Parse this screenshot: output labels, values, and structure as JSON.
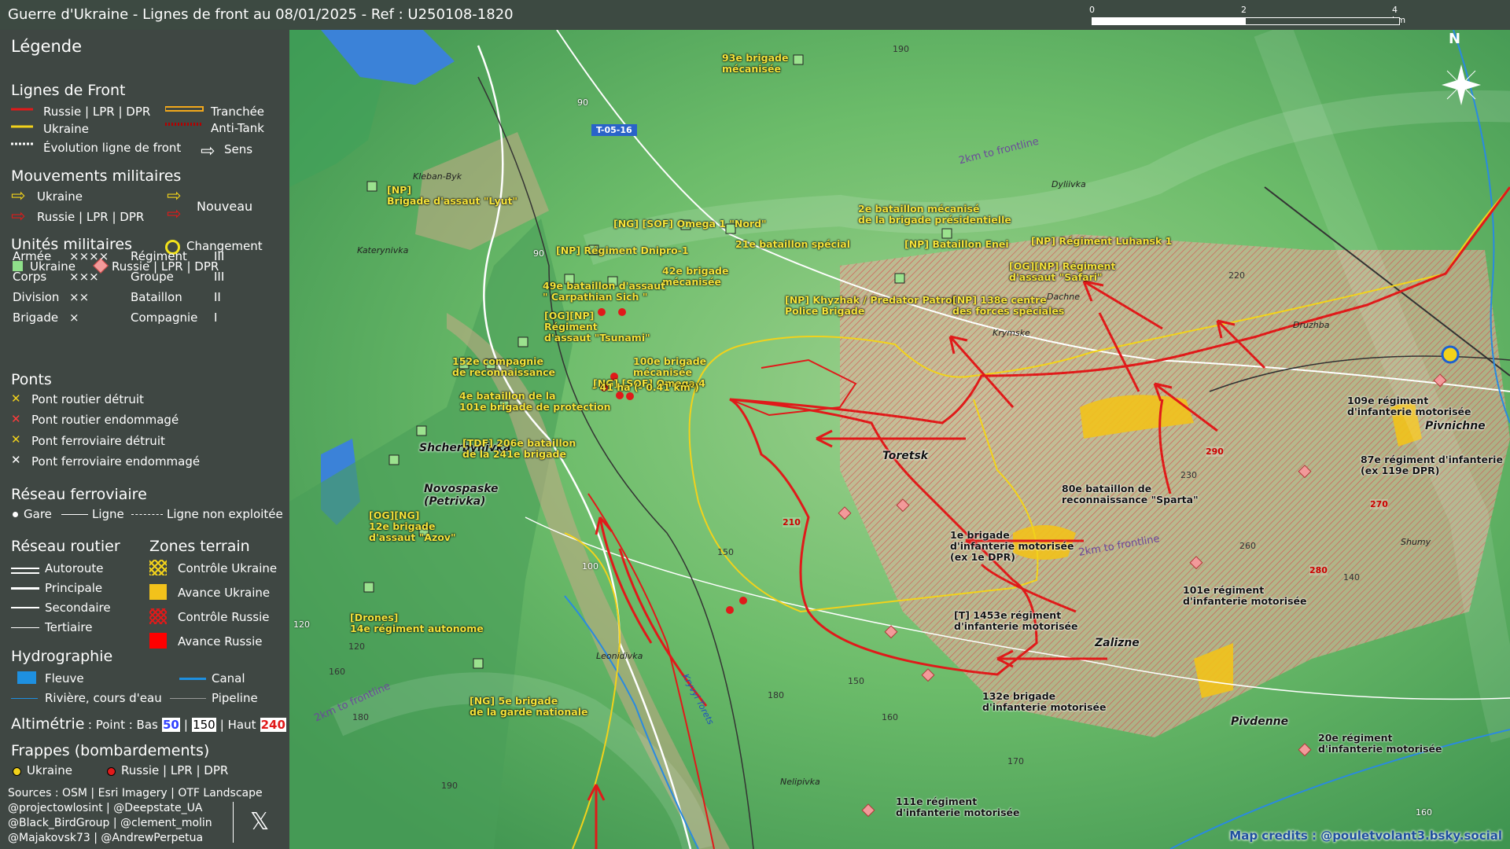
{
  "title": "Guerre d'Ukraine - Lignes de front au 08/01/2025 - Ref : U250108-1820",
  "scale": {
    "l0": "0",
    "l1": "2",
    "l2": "4 km"
  },
  "north": "N",
  "colors": {
    "russia": "#e01a1a",
    "ukraine": "#f2d21b",
    "legend_bg": "#3f4743"
  },
  "legend": {
    "title": "Légende",
    "front": {
      "title": "Lignes de Front",
      "russia": "Russie | LPR | DPR",
      "ukraine": "Ukraine",
      "tranchee": "Tranchée",
      "antitank": "Anti-Tank",
      "evolution": "Évolution ligne de front",
      "sens": "Sens"
    },
    "moves": {
      "title": "Mouvements militaires",
      "ukraine": "Ukraine",
      "russia": "Russie | LPR | DPR",
      "nouveau": "Nouveau"
    },
    "units": {
      "title": "Unités militaires",
      "changement": "Changement",
      "ukraine": "Ukraine",
      "russia": "Russie | LPR | DPR",
      "rows": [
        {
          "a": "Armée",
          "as": "××××",
          "b": "Régiment",
          "bs": "III"
        },
        {
          "a": "Corps",
          "as": "×××",
          "b": "Groupe",
          "bs": "III"
        },
        {
          "a": "Division",
          "as": "××",
          "b": "Bataillon",
          "bs": "II"
        },
        {
          "a": "Brigade",
          "as": "×",
          "b": "Compagnie",
          "bs": "I"
        }
      ]
    },
    "bridges": {
      "title": "Ponts",
      "b1": "Pont routier détruit",
      "b2": "Pont routier endommagé",
      "b3": "Pont ferroviaire détruit",
      "b4": "Pont ferroviaire endommagé"
    },
    "rail": {
      "title": "Réseau ferroviaire",
      "gare": "Gare",
      "ligne": "Ligne",
      "non": "Ligne non exploitée"
    },
    "road": {
      "title": "Réseau routier",
      "r1": "Autoroute",
      "r2": "Principale",
      "r3": "Secondaire",
      "r4": "Tertiaire"
    },
    "zones": {
      "title": "Zones terrain",
      "z1": "Contrôle Ukraine",
      "z2": "Avance Ukraine",
      "z3": "Contrôle Russie",
      "z4": "Avance Russie"
    },
    "hydro": {
      "title": "Hydrographie",
      "h1": "Fleuve",
      "h2": "Canal",
      "h3": "Rivière, cours d'eau",
      "h4": "Pipeline"
    },
    "alti": {
      "title": "Altimétrie",
      "point": ": Point : Bas",
      "low": "50",
      "mid": "150",
      "haut": "| Haut",
      "high": "240",
      "sep": "|"
    },
    "strikes": {
      "title": "Frappes (bombardements)",
      "ukraine": "Ukraine",
      "russia": "Russie | LPR | DPR"
    },
    "sources": [
      "Sources : OSM | Esri Imagery | OTF Landscape",
      "@projectowlosint | @Deepstate_UA",
      "@Black_BirdGroup | @clement_molin",
      "@Majakovsk73 | @AndrewPerpetua"
    ]
  },
  "map": {
    "places": [
      {
        "t": "Toretsk"
      },
      {
        "t": "Pivnichne"
      },
      {
        "t": "Zalizne"
      },
      {
        "t": "Pivdenne"
      },
      {
        "t": "Shcherbynivka"
      },
      {
        "t": "Novospaske\n(Petrivka)"
      }
    ],
    "small_places": [
      {
        "t": "Kleban-Byk"
      },
      {
        "t": "Katerynivka"
      },
      {
        "t": "Dyliivka"
      },
      {
        "t": "Dachne"
      },
      {
        "t": "Krymske"
      },
      {
        "t": "Druzhba"
      },
      {
        "t": "Shumy"
      },
      {
        "t": "Leonidivka"
      },
      {
        "t": "Nelipivka"
      }
    ],
    "ua_units": [
      {
        "t": "93e brigade\nmécanisée"
      },
      {
        "t": "[NP]\nBrigade d'assaut \"Lyut\""
      },
      {
        "t": "[NG] [SOF] Omega 1 \"Nord\""
      },
      {
        "t": "2e bataillon mécanisé\nde la brigade présidentielle"
      },
      {
        "t": "[NP] Régiment Dnipro-1"
      },
      {
        "t": "21e bataillon spécial"
      },
      {
        "t": "[NP] Bataillon Enei"
      },
      {
        "t": "[NP] Régiment Luhansk 1"
      },
      {
        "t": "42e brigade\nmécanisée"
      },
      {
        "t": "[OG][NP] Régiment\nd'assaut \"Safari\""
      },
      {
        "t": "49e bataillon d'assaut\n\" Carpathian Sich \""
      },
      {
        "t": "[NP] Khyzhak / Predator Patrol\nPolice Brigade"
      },
      {
        "t": "[NP] 138e centre\ndes forces spéciales"
      },
      {
        "t": "[OG][NP]\nRégiment\nd'assaut \"Tsunami\""
      },
      {
        "t": "152e compagnie\nde reconnaissance"
      },
      {
        "t": "100e brigade\nmécanisée"
      },
      {
        "t": "[NG] [SOF] Omega 4"
      },
      {
        "t": "4e bataillon de la\n101e brigade de protection"
      },
      {
        "t": "[TDF] 206e bataillon\nde la 241e brigade"
      },
      {
        "t": "[OG][NG]\n12e brigade\nd'assaut \"Azov\""
      },
      {
        "t": "[Drones]\n14e régiment autonome"
      },
      {
        "t": "[NG] 5e brigade\nde la garde nationale"
      },
      {
        "t": "- 41 ha (- 0.41 km²)"
      }
    ],
    "ru_units": [
      {
        "t": "109e régiment\nd'infanterie motorisée"
      },
      {
        "t": "87e régiment d'infanterie\n(ex 119e DPR)"
      },
      {
        "t": "80e bataillon de\nreconnaissance \"Sparta\""
      },
      {
        "t": "1e brigade\nd'infanterie motorisée\n(ex 1e DPR)"
      },
      {
        "t": "101e régiment\nd'infanterie motorisée"
      },
      {
        "t": "[T] 1453e régiment\nd'infanterie motorisée"
      },
      {
        "t": "132e brigade\nd'infanterie motorisée"
      },
      {
        "t": "20e régiment\nd'infanterie motorisée"
      },
      {
        "t": "111e régiment\nd'infanterie motorisée"
      }
    ],
    "roads": [
      {
        "t": "T-05-16"
      }
    ],
    "road_nums": [
      "90",
      "90",
      "100",
      "120",
      "160"
    ],
    "frontline_labels": [
      "2km to frontline",
      "2km to frontline",
      "2km to frontline"
    ],
    "river": "Kryvyi Torets",
    "alts": [
      "190",
      "220",
      "230",
      "260",
      "150",
      "150",
      "160",
      "170",
      "180",
      "120",
      "160",
      "180",
      "190",
      "140"
    ],
    "alts_red": [
      "290",
      "210",
      "270",
      "280"
    ],
    "credit": "Map credits : @pouletvolant3.bsky.social"
  }
}
